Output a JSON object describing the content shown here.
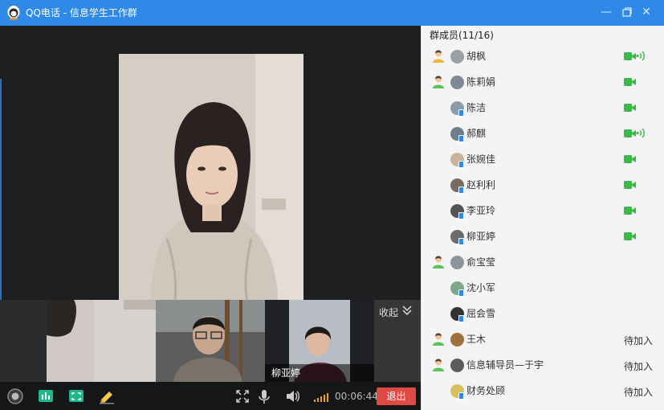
{
  "window": {
    "title": "QQ电话 - 信息学生工作群",
    "buttons": [
      "minimize-icon",
      "restore-icon",
      "close-icon"
    ]
  },
  "videos": {
    "main": {
      "person": "main-speaker"
    },
    "thumbnails": [
      {
        "name": ""
      },
      {
        "name": ""
      },
      {
        "name": "柳亚婷"
      }
    ],
    "collapse_label": "收起"
  },
  "toolbar": {
    "icons": [
      "camera-icon",
      "chart-icon",
      "screen-share-icon",
      "whiteboard-icon",
      "fullscreen-icon",
      "microphone-icon",
      "speaker-icon",
      "signal-icon"
    ],
    "timer": "00:06:44",
    "exit_label": "退出"
  },
  "panel": {
    "title": "群成员(11/16)",
    "members": [
      {
        "name": "胡枫",
        "role": "owner",
        "camera": true,
        "speaking": true,
        "status": ""
      },
      {
        "name": "陈莉娟",
        "role": "admin",
        "camera": true,
        "speaking": false,
        "status": ""
      },
      {
        "name": "陈洁",
        "role": "",
        "camera": true,
        "speaking": false,
        "status": ""
      },
      {
        "name": "郝麒",
        "role": "",
        "camera": true,
        "speaking": true,
        "status": ""
      },
      {
        "name": "张婉佳",
        "role": "",
        "camera": true,
        "speaking": false,
        "status": ""
      },
      {
        "name": "赵利利",
        "role": "",
        "camera": true,
        "speaking": false,
        "status": ""
      },
      {
        "name": "李亚玲",
        "role": "",
        "camera": true,
        "speaking": false,
        "status": ""
      },
      {
        "name": "柳亚婷",
        "role": "",
        "camera": true,
        "speaking": false,
        "status": ""
      },
      {
        "name": "俞宝莹",
        "role": "admin",
        "camera": false,
        "speaking": false,
        "status": ""
      },
      {
        "name": "沈小军",
        "role": "",
        "camera": false,
        "speaking": false,
        "status": ""
      },
      {
        "name": "屈会雪",
        "role": "",
        "camera": false,
        "speaking": false,
        "status": ""
      },
      {
        "name": "王木",
        "role": "admin",
        "camera": false,
        "speaking": false,
        "status": "待加入"
      },
      {
        "name": "信息辅导员—于宇",
        "role": "admin",
        "camera": false,
        "speaking": false,
        "status": "待加入"
      },
      {
        "name": "财务处顾",
        "role": "",
        "camera": false,
        "speaking": false,
        "status": "待加入"
      }
    ]
  },
  "colors": {
    "titlebar": "#2e8ae6",
    "camera_green": "#3cb84a",
    "exit_red": "#e04a45",
    "owner_yellow": "#f2b33d",
    "admin_green": "#5ac05c"
  }
}
